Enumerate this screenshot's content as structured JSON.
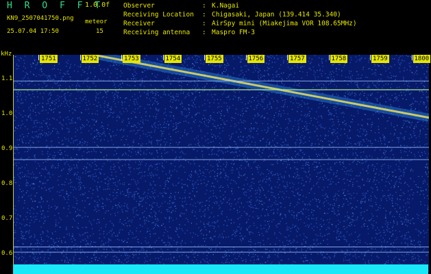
{
  "header": {
    "app_title": "H R O F F T",
    "version": "1.0.0f",
    "filename": "KN9_2507041750.png",
    "meteor_label": "meteor",
    "meteor_count": "15",
    "datetime": "25.07.04 17:50",
    "info": [
      {
        "key": "Observer",
        "sep": ":",
        "value": "K.Nagai"
      },
      {
        "key": "Receiving Location",
        "sep": ":",
        "value": "Chigasaki, Japan (139.414 35.340)"
      },
      {
        "key": "Receiver",
        "sep": ":",
        "value": "AirSpy mini (Miakejima VOR 108.65MHz)"
      },
      {
        "key": "Receiving antenna",
        "sep": ":",
        "value": "Maspro FM-3"
      }
    ]
  },
  "axis": {
    "y_unit": "kHz",
    "y_ticks": [
      "1.1",
      "1.0",
      "0.9",
      "0.8",
      "0.7",
      "0.6"
    ],
    "x_ticks": [
      "1751",
      "1752",
      "1753",
      "1754",
      "1755",
      "1756",
      "1757",
      "1758",
      "1759",
      "1800"
    ]
  },
  "colors": {
    "label": "#e6e600",
    "title": "#2fe08a",
    "background": "#071a6a",
    "band": "#18e8f8"
  },
  "chart_data": {
    "type": "heatmap",
    "x_ticks": [
      "1751",
      "1752",
      "1753",
      "1754",
      "1755",
      "1756",
      "1757",
      "1758",
      "1759",
      "1800"
    ],
    "y_ticks": [
      1.1,
      1.0,
      0.9,
      0.8,
      0.7,
      0.6
    ],
    "ylabel": "kHz",
    "ylim": [
      0.57,
      1.17
    ],
    "features": [
      {
        "kind": "doppler_trace",
        "x_start": "1752",
        "y_start": 1.17,
        "x_end": "1800",
        "y_end": 0.99
      },
      {
        "kind": "horizontal_line",
        "y": 1.07
      },
      {
        "kind": "horizontal_line",
        "y": 1.095
      },
      {
        "kind": "horizontal_line",
        "y": 0.905
      },
      {
        "kind": "horizontal_line",
        "y": 0.87
      },
      {
        "kind": "horizontal_line",
        "y": 0.62
      },
      {
        "kind": "horizontal_line",
        "y": 0.605
      }
    ]
  }
}
